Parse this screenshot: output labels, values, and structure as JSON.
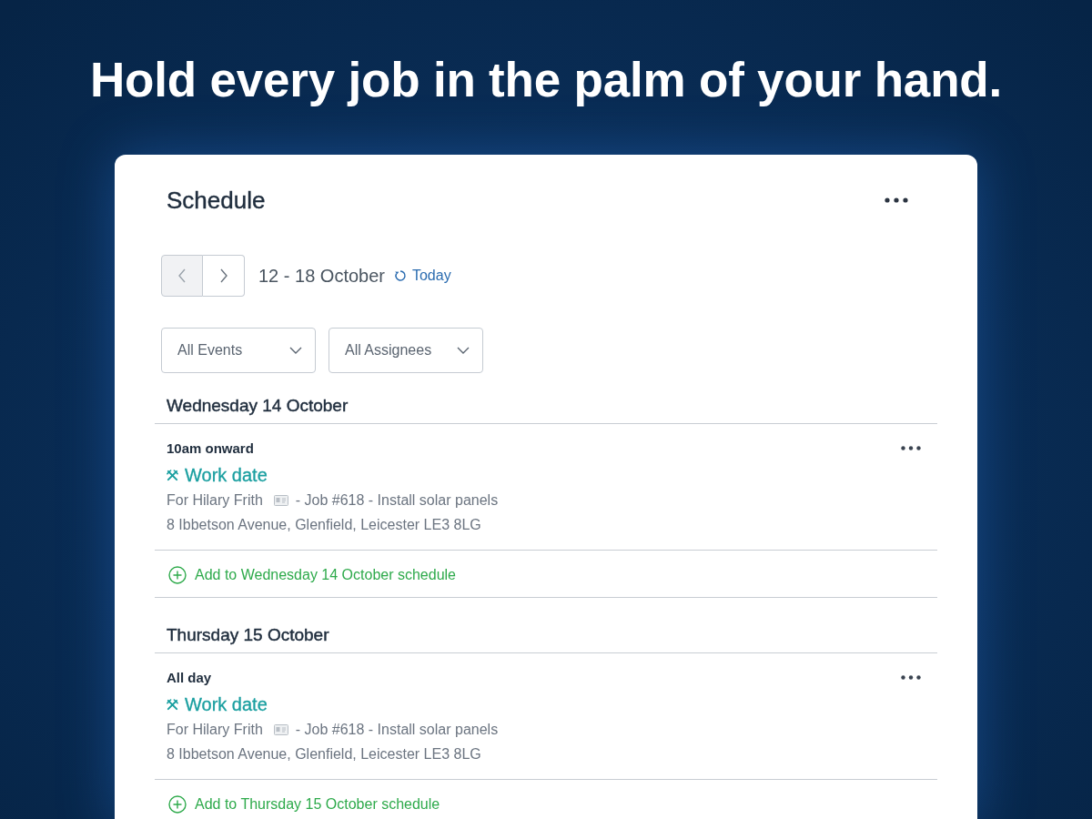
{
  "headline": "Hold every job in the palm of your hand.",
  "schedule": {
    "title": "Schedule",
    "date_nav": {
      "prev": {
        "disabled": true
      },
      "next": {
        "disabled": false
      },
      "range": "12 - 18 October",
      "today_link": "Today"
    },
    "filters": [
      {
        "value": "All Events"
      },
      {
        "value": "All Assignees"
      }
    ],
    "days": [
      {
        "heading": "Wednesday 14 October",
        "events": [
          {
            "time": "10am onward",
            "title": "Work date",
            "client": "For Hilary Frith",
            "job": "- Job #618 - Install solar panels",
            "address": "8 Ibbetson Avenue, Glenfield, Leicester LE3 8LG"
          }
        ],
        "add_link": "Add to Wednesday 14 October schedule"
      },
      {
        "heading": "Thursday 15 October",
        "events": [
          {
            "time": "All day",
            "title": "Work date",
            "client": "For Hilary Frith",
            "job": "- Job #618 - Install solar panels",
            "address": "8 Ibbetson Avenue, Glenfield, Leicester LE3 8LG"
          }
        ],
        "add_link": "Add to Thursday 15 October schedule"
      }
    ]
  }
}
